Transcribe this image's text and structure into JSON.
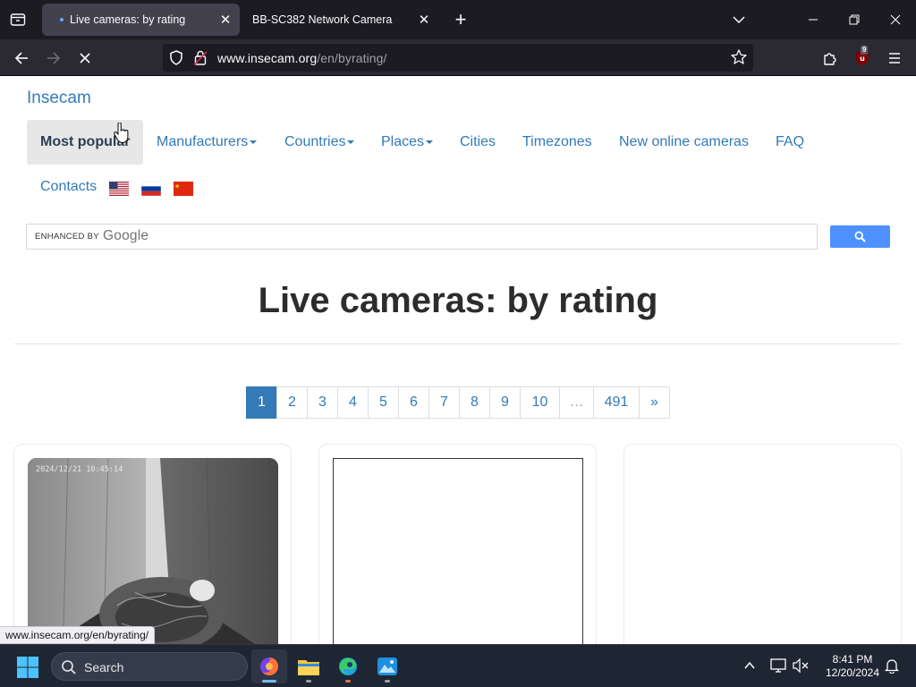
{
  "browser": {
    "tabs": [
      {
        "title": "Live cameras: by rating",
        "active": true
      },
      {
        "title": "BB-SC382 Network Camera",
        "active": false
      }
    ],
    "url_host": "www.insecam.org",
    "url_path": "/en/byrating/",
    "extension_badge": "9",
    "status_url": "www.insecam.org/en/byrating/"
  },
  "site": {
    "brand": "Insecam",
    "menu": [
      {
        "label": "Most popular",
        "active": true
      },
      {
        "label": "Manufacturers",
        "dropdown": true
      },
      {
        "label": "Countries",
        "dropdown": true
      },
      {
        "label": "Places",
        "dropdown": true
      },
      {
        "label": "Cities"
      },
      {
        "label": "Timezones"
      },
      {
        "label": "New online cameras"
      },
      {
        "label": "FAQ"
      },
      {
        "label": "Contacts"
      }
    ],
    "languages": [
      "us-flag",
      "russia-flag",
      "china-flag"
    ],
    "search": {
      "enhanced_by": "ENHANCED BY",
      "provider": "Google"
    },
    "heading": "Live cameras: by rating",
    "pagination": [
      "1",
      "2",
      "3",
      "4",
      "5",
      "6",
      "7",
      "8",
      "9",
      "10",
      "…",
      "491",
      "»"
    ],
    "current_page": "1",
    "cameras": [
      {
        "timestamp": "2024/12/21   10:45:14"
      }
    ]
  },
  "taskbar": {
    "search_label": "Search",
    "time": "8:41 PM",
    "date": "12/20/2024"
  },
  "colors": {
    "link": "#337ab7",
    "active_page": "#337ab7",
    "search_button": "#4d90fe",
    "taskbar": "#1f2633"
  }
}
